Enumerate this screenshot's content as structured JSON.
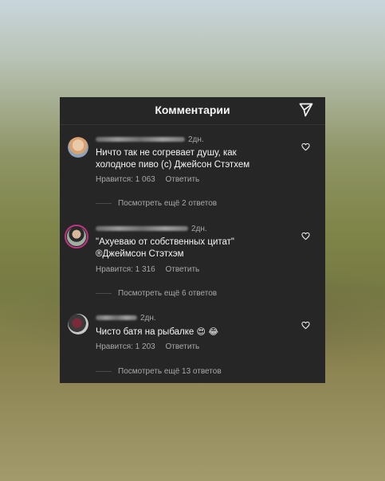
{
  "header": {
    "title": "Комментарии",
    "send_icon": "send-icon"
  },
  "comments": [
    {
      "username_blurred": true,
      "time": "2дн.",
      "text_lines": [
        "Ничто так не согревает душу, как",
        "холодное пиво (с) Джейсон Стэтхем"
      ],
      "likes_label": "Нравится: 1 063",
      "reply_label": "Ответить",
      "replies_label": "Посмотреть ещё 2 ответов"
    },
    {
      "username_blurred": true,
      "time": "2дн.",
      "text_lines": [
        "\"Ахуеваю от собственных цитат\"",
        "®Джеймсон Стэтхэм"
      ],
      "likes_label": "Нравится: 1 316",
      "reply_label": "Ответить",
      "replies_label": "Посмотреть ещё 6 ответов"
    },
    {
      "username_blurred": true,
      "time": "2дн.",
      "text_lines": [
        "Чисто батя на рыбалке"
      ],
      "emojis": [
        "😍",
        "😂"
      ],
      "likes_label": "Нравится: 1 203",
      "reply_label": "Ответить",
      "replies_label": "Посмотреть ещё 13 ответов"
    }
  ],
  "colors": {
    "panel_bg": "#262626",
    "text": "#f5f5f5",
    "muted": "#a8a8a8",
    "story_ring": "#c13584"
  }
}
